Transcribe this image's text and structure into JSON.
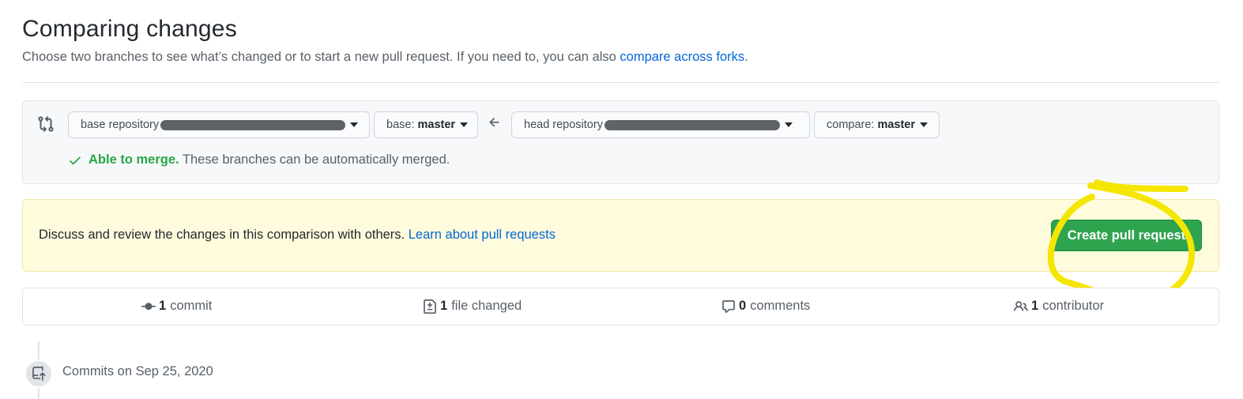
{
  "header": {
    "title": "Comparing changes",
    "subtitle": "Choose two branches to see what’s changed or to start a new pull request. If you need to, you can also ",
    "subtitle_link": "compare across forks",
    "subtitle_end": "."
  },
  "range": {
    "base_repo_label": "base repository",
    "base_label": "base:",
    "base_value": "master",
    "head_repo_label": "head repository",
    "compare_label": "compare:",
    "compare_value": "master",
    "merge_ok": "Able to merge.",
    "merge_text": " These branches can be automatically merged."
  },
  "flash": {
    "text": "Discuss and review the changes in this comparison with others. ",
    "link": "Learn about pull requests",
    "button": "Create pull request"
  },
  "stats": {
    "commits_count": "1",
    "commits_label": "commit",
    "files_count": "1",
    "files_label": "file changed",
    "comments_count": "0",
    "comments_label": "comments",
    "contributors_count": "1",
    "contributors_label": "contributor"
  },
  "timeline": {
    "heading": "Commits on Sep 25, 2020"
  },
  "colors": {
    "accent_green": "#2ea44f",
    "link_blue": "#0366d6",
    "annotation_yellow": "#f5e600"
  },
  "icons": [
    "git-compare-icon",
    "arrow-left-icon",
    "check-icon",
    "git-commit-icon",
    "file-diff-icon",
    "comment-icon",
    "people-icon",
    "repo-push-icon"
  ]
}
